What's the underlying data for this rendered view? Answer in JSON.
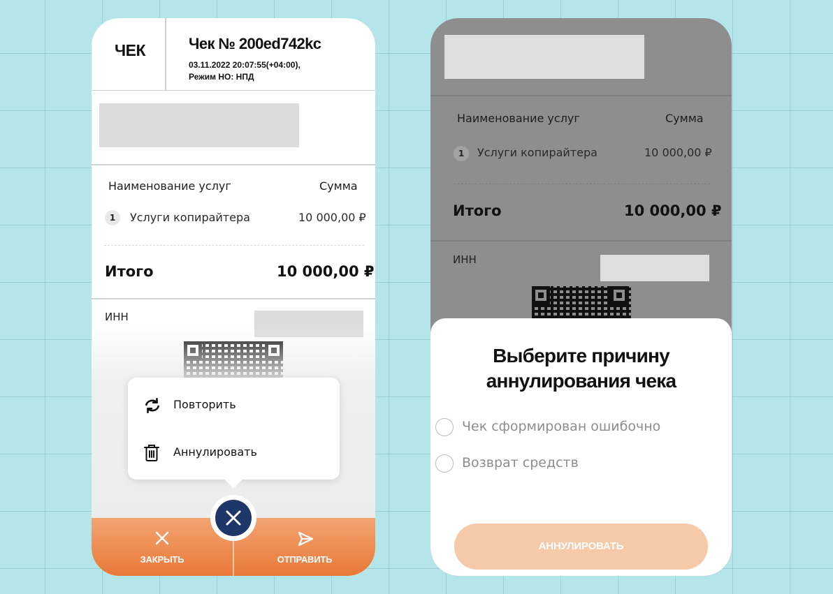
{
  "left_screen": {
    "header": {
      "label": "ЧЕК",
      "title": "Чек № 200ed742kc",
      "subtitle": "03.11.2022 20:07:55(+04:00),\nРежим НО: НПД"
    },
    "table": {
      "col_name": "Наименование услуг",
      "col_sum": "Сумма",
      "item_index": "1",
      "item_name": "Услуги копирайтера",
      "item_amount": "10 000,00 ₽",
      "total_label": "Итого",
      "total_value": "10 000,00 ₽"
    },
    "inn_label": "ИНН",
    "menu": {
      "repeat": "Повторить",
      "annul": "Аннулировать"
    },
    "bottom_bar": {
      "close": "ЗАКРЫТЬ",
      "send": "ОТПРАВИТЬ"
    }
  },
  "right_screen": {
    "table": {
      "col_name": "Наименование услуг",
      "col_sum": "Сумма",
      "item_index": "1",
      "item_name": "Услуги копирайтера",
      "item_amount": "10 000,00 ₽",
      "total_label": "Итого",
      "total_value": "10 000,00 ₽"
    },
    "inn_label": "ИНН",
    "sheet": {
      "title": "Выберите причину\nаннулирования чека",
      "options": [
        "Чек сформирован ошибочно",
        "Возврат средств"
      ],
      "button": "АННУЛИРОВАТЬ"
    }
  },
  "colors": {
    "background": "#b4e5e8",
    "accent_orange": "#e97938",
    "navy": "#1f3668",
    "disabled_button": "#f6c9a9"
  }
}
